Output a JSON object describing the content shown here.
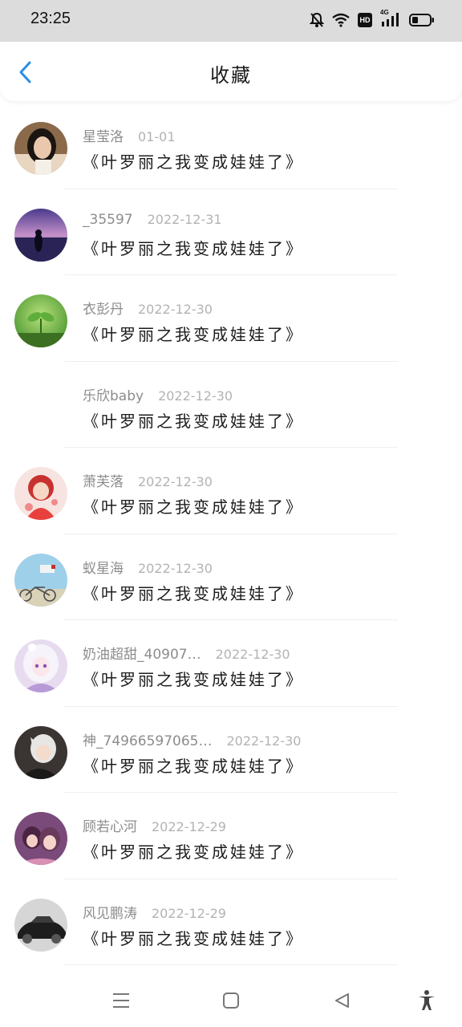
{
  "status_bar": {
    "time": "23:25",
    "icons": [
      "mute-bell-icon",
      "wifi-icon",
      "hd-icon",
      "4g-signal-icon",
      "battery-icon"
    ],
    "hd_label": "HD",
    "network_label": "4G"
  },
  "header": {
    "title": "收藏",
    "back_icon": "chevron-left-icon",
    "accent": "#2a8ee8"
  },
  "favorites": [
    {
      "name": "星莹洛",
      "date": "01-01",
      "title": "《叶罗丽之我变成娃娃了》",
      "avatar": "photo-woman"
    },
    {
      "name": "_35597",
      "date": "2022-12-31",
      "title": "《叶罗丽之我变成娃娃了》",
      "avatar": "purple-sunset"
    },
    {
      "name": "衣彭丹",
      "date": "2022-12-30",
      "title": "《叶罗丽之我变成娃娃了》",
      "avatar": "green-sprout"
    },
    {
      "name": "乐欣baby",
      "date": "2022-12-30",
      "title": "《叶罗丽之我变成娃娃了》",
      "avatar": "none"
    },
    {
      "name": "萧芙落",
      "date": "2022-12-30",
      "title": "《叶罗丽之我变成娃娃了》",
      "avatar": "anime-red"
    },
    {
      "name": "蚁星海",
      "date": "2022-12-30",
      "title": "《叶罗丽之我变成娃娃了》",
      "avatar": "bicycle-sky"
    },
    {
      "name": "奶油超甜_40907…",
      "date": "2022-12-30",
      "title": "《叶罗丽之我变成娃娃了》",
      "avatar": "anime-lilac"
    },
    {
      "name": "神_74966597065…",
      "date": "2022-12-30",
      "title": "《叶罗丽之我变成娃娃了》",
      "avatar": "anime-dark"
    },
    {
      "name": "顾若心河",
      "date": "2022-12-29",
      "title": "《叶罗丽之我变成娃娃了》",
      "avatar": "anime-pink"
    },
    {
      "name": "风见鹏涛",
      "date": "2022-12-29",
      "title": "《叶罗丽之我变成娃娃了》",
      "avatar": "car"
    }
  ],
  "nav_bar": {
    "items": [
      "menu-icon",
      "home-square-icon",
      "back-triangle-icon",
      "accessibility-icon"
    ]
  }
}
